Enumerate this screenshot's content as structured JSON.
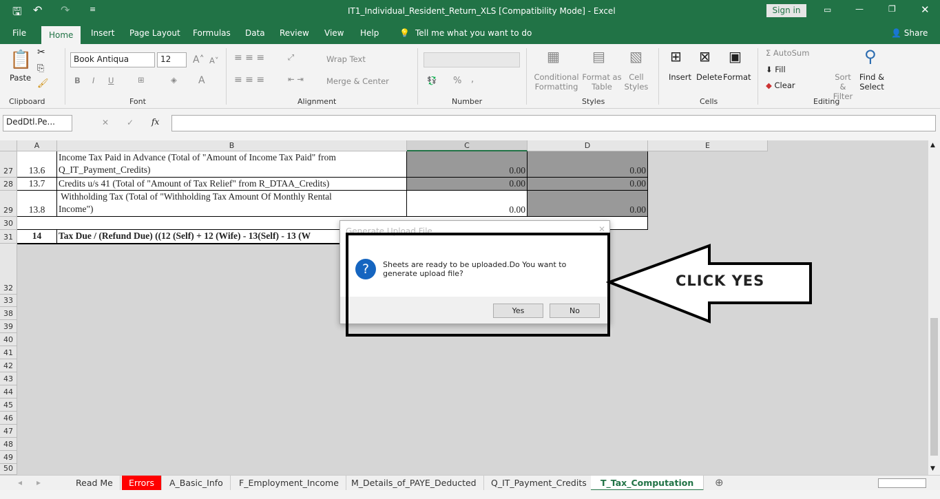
{
  "window": {
    "title": "IT1_Individual_Resident_Return_XLS  [Compatibility Mode]  -  Excel",
    "sign_in": "Sign in",
    "share": "Share"
  },
  "ribbon_tabs": [
    "File",
    "Home",
    "Insert",
    "Page Layout",
    "Formulas",
    "Data",
    "Review",
    "View",
    "Help"
  ],
  "tell_me": "Tell me what you want to do",
  "ribbon": {
    "clipboard": {
      "label": "Clipboard",
      "paste": "Paste"
    },
    "font": {
      "label": "Font",
      "name": "Book Antiqua",
      "size": "12",
      "bold": "B",
      "italic": "I",
      "underline": "U"
    },
    "alignment": {
      "label": "Alignment",
      "wrap": "Wrap Text",
      "merge": "Merge & Center"
    },
    "number": {
      "label": "Number",
      "percent": "%",
      "comma": ","
    },
    "styles": {
      "label": "Styles",
      "conditional": [
        "Conditional",
        "Formatting"
      ],
      "format_table": [
        "Format as",
        "Table"
      ],
      "cell_styles": [
        "Cell",
        "Styles"
      ]
    },
    "cells": {
      "label": "Cells",
      "insert": "Insert",
      "delete": "Delete",
      "format": "Format"
    },
    "editing": {
      "label": "Editing",
      "autosum": "AutoSum",
      "fill": "Fill",
      "clear": "Clear",
      "sort": [
        "Sort &",
        "Filter"
      ],
      "find": [
        "Find &",
        "Select"
      ]
    }
  },
  "formula_bar": {
    "name_box": "DedDtl.Pe...",
    "fx": "fx",
    "value": ""
  },
  "columns": [
    "A",
    "B",
    "C",
    "D",
    "E"
  ],
  "rows": [
    {
      "num": "27",
      "a": "13.6",
      "b": [
        "Income Tax Paid in Advance (Total of \"Amount of Income Tax Paid\" from",
        "Q_IT_Payment_Credits)"
      ],
      "c": "0.00",
      "d": "0.00"
    },
    {
      "num": "28",
      "a": "13.7",
      "b": [
        "Credits u/s 41 (Total of \"Amount of Tax Relief\" from R_DTAA_Credits)"
      ],
      "c": "0.00",
      "d": "0.00"
    },
    {
      "num": "29",
      "a": "13.8",
      "b": [
        " Withholding Tax (Total of \"Withholding Tax Amount Of Monthly Rental",
        "Income\")"
      ],
      "c": "0.00",
      "d": "0.00"
    },
    {
      "num": "30"
    },
    {
      "num": "31",
      "a": "14",
      "b": [
        "Tax Due / (Refund Due) ((12 (Self) + 12 (Wife) - 13(Self) - 13 (W"
      ]
    },
    {
      "num": "32"
    },
    {
      "num": "33"
    },
    {
      "num": "38"
    },
    {
      "num": "39"
    },
    {
      "num": "40"
    },
    {
      "num": "41"
    },
    {
      "num": "42"
    },
    {
      "num": "43"
    },
    {
      "num": "44"
    },
    {
      "num": "45"
    },
    {
      "num": "46"
    },
    {
      "num": "47"
    },
    {
      "num": "48"
    },
    {
      "num": "49"
    },
    {
      "num": "50"
    }
  ],
  "dialog": {
    "title": "Generate Upload File",
    "message": "Sheets are ready to be uploaded.Do You want to generate upload file?",
    "icon": "question-icon",
    "yes": "Yes",
    "no": "No"
  },
  "annotation": {
    "text": "CLICK YES"
  },
  "sheet_tabs": [
    {
      "label": "Read Me"
    },
    {
      "label": "Errors",
      "color": "#ff0000"
    },
    {
      "label": "A_Basic_Info"
    },
    {
      "label": "F_Employment_Income"
    },
    {
      "label": "M_Details_of_PAYE_Deducted"
    },
    {
      "label": "Q_IT_Payment_Credits"
    },
    {
      "label": "T_Tax_Computation",
      "active": true
    }
  ],
  "colors": {
    "brand": "#217346",
    "shaded_cell": "#999999",
    "error_tab": "#ff0000"
  }
}
